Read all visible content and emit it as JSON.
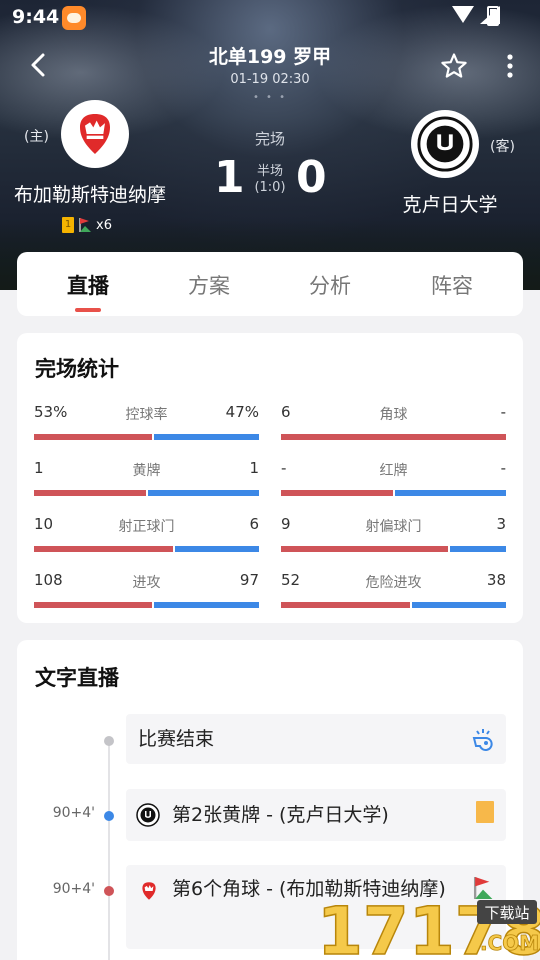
{
  "status": {
    "time": "9:44"
  },
  "header": {
    "title": "北单199 罗甲",
    "datetime": "01-19 02:30",
    "dots": "• • •"
  },
  "match": {
    "home": {
      "tag": "(主)",
      "name": "布加勒斯特迪纳摩",
      "corner_count": "x6"
    },
    "away": {
      "tag": "(客)",
      "name": "克卢日大学"
    },
    "status": "完场",
    "score_home": "1",
    "score_away": "0",
    "half_label": "半场",
    "half_score": "(1:0)"
  },
  "tabs": [
    {
      "label": "直播",
      "active": true
    },
    {
      "label": "方案",
      "active": false
    },
    {
      "label": "分析",
      "active": false
    },
    {
      "label": "阵容",
      "active": false
    }
  ],
  "stats": {
    "title": "完场统计",
    "items": [
      {
        "name": "控球率",
        "home": "53%",
        "away": "47%",
        "home_share": 0.53
      },
      {
        "name": "角球",
        "home": "6",
        "away": "-",
        "home_share": 1.0
      },
      {
        "name": "黄牌",
        "home": "1",
        "away": "1",
        "home_share": 0.5
      },
      {
        "name": "红牌",
        "home": "-",
        "away": "-",
        "home_share": 0.5
      },
      {
        "name": "射正球门",
        "home": "10",
        "away": "6",
        "home_share": 0.625
      },
      {
        "name": "射偏球门",
        "home": "9",
        "away": "3",
        "home_share": 0.75
      },
      {
        "name": "进攻",
        "home": "108",
        "away": "97",
        "home_share": 0.527
      },
      {
        "name": "危险进攻",
        "home": "52",
        "away": "38",
        "home_share": 0.578
      }
    ]
  },
  "live": {
    "title": "文字直播",
    "events": [
      {
        "minute": "",
        "text": "比赛结束",
        "dot_color": "#c4c4c8",
        "icon": "whistle-icon"
      },
      {
        "minute": "90+4'",
        "text": "第2张黄牌 - (克卢日大学)",
        "dot_color": "#3c88e6",
        "icon": "yellow-card-icon"
      },
      {
        "minute": "90+4'",
        "text": "第6个角球 - (布加勒斯特迪纳摩)",
        "dot_color": "#cf5458",
        "icon": "corner-flag-icon"
      }
    ]
  },
  "watermark": {
    "text": "17178",
    "sub": "下载站",
    "domain": ".COM"
  },
  "colors": {
    "home": "#cf5458",
    "away": "#3c88e6",
    "accent": "#e8514a"
  }
}
